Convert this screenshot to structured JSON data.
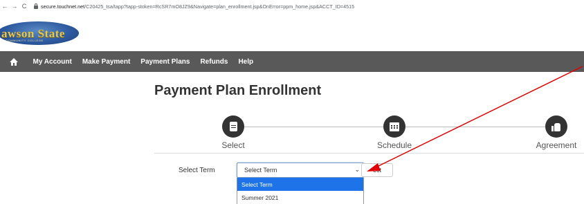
{
  "browser": {
    "url_host": "secure.touchnet.net",
    "url_path": "/C20425_tsa/tapp?tapp-stoken=RcSR7mO8JZ9&Navigate=plan_enrollment.jsp&OnError=ppm_home.jsp&ACCT_ID=4515"
  },
  "logo": {
    "name": "awson State",
    "tagline": "COMMUNITY COLLEGE"
  },
  "nav": {
    "items": [
      {
        "label": "My Account"
      },
      {
        "label": "Make Payment"
      },
      {
        "label": "Payment Plans"
      },
      {
        "label": "Refunds"
      },
      {
        "label": "Help"
      }
    ]
  },
  "page": {
    "title": "Payment Plan Enrollment"
  },
  "steps": [
    {
      "label": "Select",
      "icon": "document-icon"
    },
    {
      "label": "Schedule",
      "icon": "calendar-icon"
    },
    {
      "label": "Agreement",
      "icon": "thumbs-up-icon"
    }
  ],
  "form": {
    "term_label": "Select Term",
    "term_value": "Select Term",
    "button_label": "ect",
    "options": [
      "Select Term",
      "Summer 2021"
    ]
  },
  "colors": {
    "navbar": "#595959",
    "selected_option": "#1e73e8",
    "annotation_arrow": "#e00000"
  }
}
